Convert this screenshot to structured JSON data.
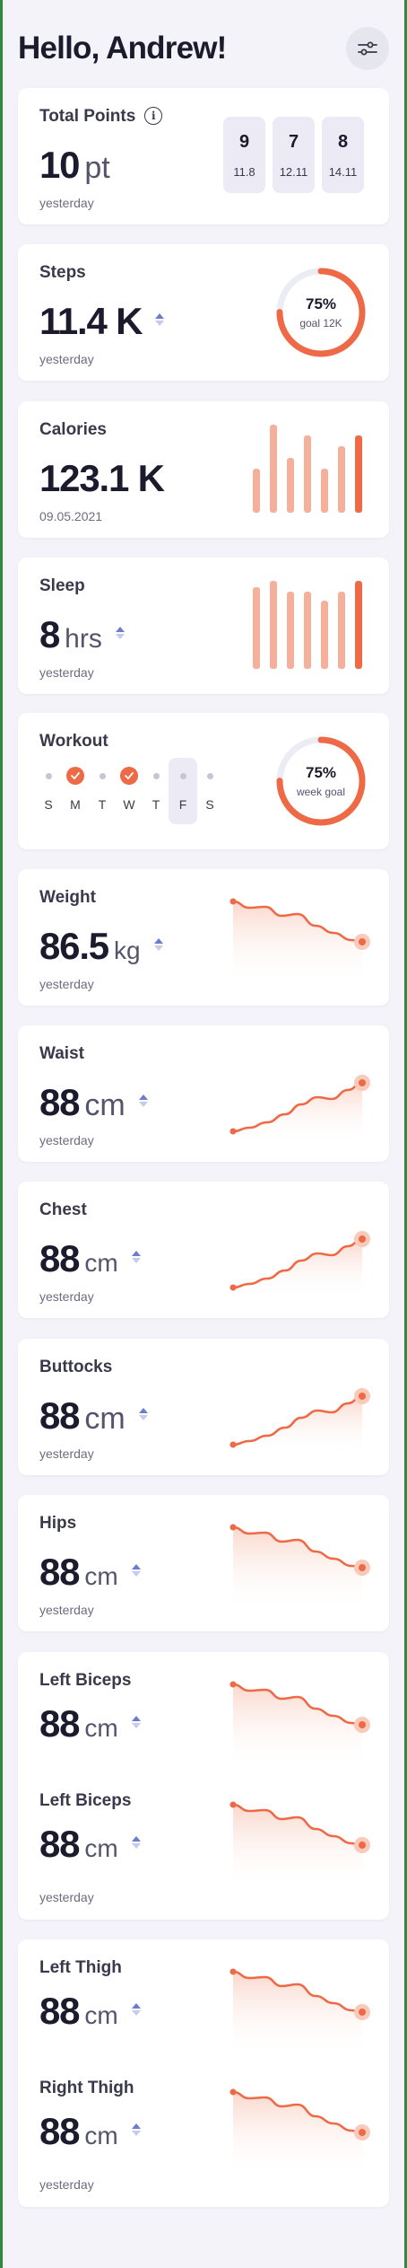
{
  "header": {
    "greeting": "Hello, Andrew!",
    "settings_icon": "sliders-icon"
  },
  "colors": {
    "accent": "#EE6A47",
    "accent_light": "#F4B09A",
    "trend_blue": "#6C7CCF",
    "card": "#FFFFFF",
    "background": "#F3F3F9"
  },
  "total_points": {
    "title": "Total Points",
    "value": "10",
    "unit": "pt",
    "caption": "yesterday",
    "dates": [
      {
        "day": "9",
        "month": "11.8"
      },
      {
        "day": "7",
        "month": "12.11"
      },
      {
        "day": "8",
        "month": "14.11"
      }
    ]
  },
  "steps": {
    "title": "Steps",
    "value": "11.4 K",
    "caption": "yesterday",
    "gauge_pct": "75%",
    "gauge_label": "goal 12K",
    "progress": 0.75
  },
  "calories": {
    "title": "Calories",
    "value": "123.1 K",
    "caption": "09.05.2021",
    "bars": [
      0.5,
      1.0,
      0.62,
      0.88,
      0.5,
      0.75,
      0.88
    ]
  },
  "sleep": {
    "title": "Sleep",
    "value": "8",
    "unit": "hrs",
    "caption": "yesterday",
    "bars": [
      0.93,
      1.0,
      0.88,
      0.88,
      0.78,
      0.88,
      1.0
    ]
  },
  "workout": {
    "title": "Workout",
    "gauge_pct": "75%",
    "gauge_label": "week goal",
    "progress": 0.75,
    "days": [
      {
        "label": "S",
        "done": false
      },
      {
        "label": "M",
        "done": true
      },
      {
        "label": "T",
        "done": false
      },
      {
        "label": "W",
        "done": true
      },
      {
        "label": "T",
        "done": false
      },
      {
        "label": "F",
        "done": false,
        "selected": true
      },
      {
        "label": "S",
        "done": false
      }
    ]
  },
  "weight": {
    "title": "Weight",
    "value": "86.5",
    "unit": "kg",
    "caption": "yesterday",
    "trend": "down"
  },
  "waist": {
    "title": "Waist",
    "value": "88",
    "unit": "cm",
    "caption": "yesterday",
    "trend": "up"
  },
  "chest": {
    "title": "Chest",
    "value": "88",
    "unit": "cm",
    "caption": "yesterday",
    "trend": "up"
  },
  "buttocks": {
    "title": "Buttocks",
    "value": "88",
    "unit": "cm",
    "caption": "yesterday",
    "trend": "up"
  },
  "hips": {
    "title": "Hips",
    "value": "88",
    "unit": "cm",
    "caption": "yesterday",
    "trend": "down"
  },
  "biceps": {
    "left_title": "Left Biceps",
    "left_value": "88",
    "left_unit": "cm",
    "right_title": "Left Biceps",
    "right_value": "88",
    "right_unit": "cm",
    "caption": "yesterday"
  },
  "thigh": {
    "left_title": "Left Thigh",
    "left_value": "88",
    "left_unit": "cm",
    "right_title": "Right Thigh",
    "right_value": "88",
    "right_unit": "cm",
    "caption": "yesterday"
  }
}
